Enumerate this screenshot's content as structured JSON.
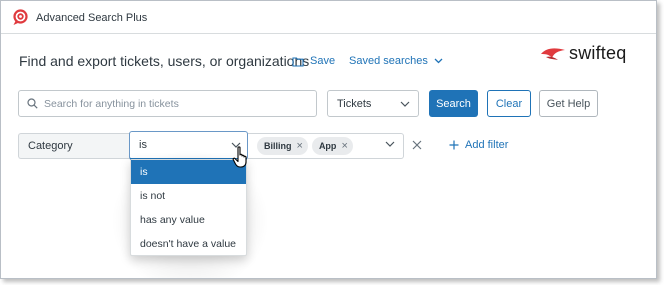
{
  "app": {
    "title": "Advanced Search Plus",
    "accent": "#1f73b7",
    "logo_color": "#e03a3e"
  },
  "header": {
    "headline": "Find and export tickets, users, or organizations",
    "save_label": "Save",
    "saved_searches_label": "Saved searches",
    "brand_name": "swifteq"
  },
  "search": {
    "placeholder": "Search for anything in tickets",
    "value": "",
    "type_selected": "Tickets",
    "search_label": "Search",
    "clear_label": "Clear",
    "help_label": "Get Help"
  },
  "filter": {
    "field": "Category",
    "operator": "is",
    "values": [
      "Billing",
      "App"
    ],
    "add_filter_label": "Add filter"
  },
  "operator_menu": {
    "selected_index": 0,
    "items": [
      "is",
      "is not",
      "has any value",
      "doesn't have a value"
    ]
  }
}
